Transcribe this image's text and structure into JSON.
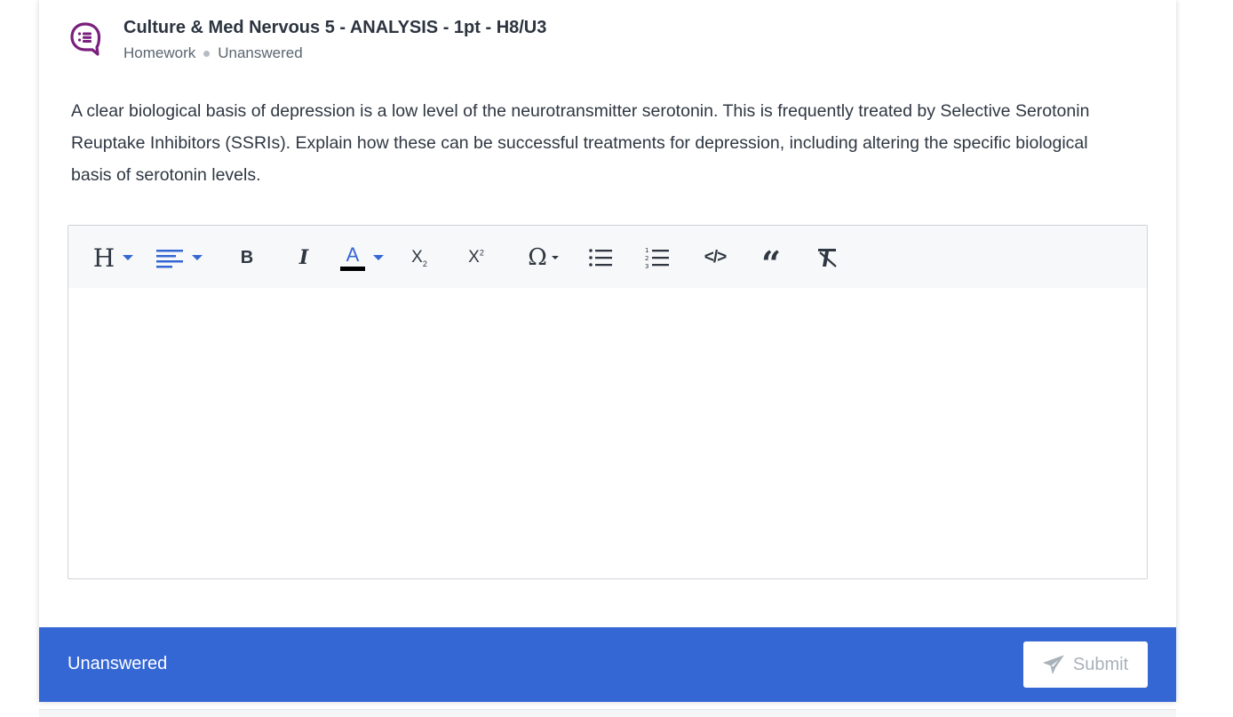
{
  "question": {
    "title": "Culture & Med Nervous 5 - ANALYSIS - 1pt - H8/U3",
    "type": "Homework",
    "status": "Unanswered",
    "icon": "question-bubble-icon",
    "prompt": "A clear biological basis of depression is a low level of the neurotransmitter serotonin. This is frequently treated by Selective Serotonin Reuptake Inhibitors (SSRIs). Explain how these can be successful treatments for depression, including altering the specific biological basis of serotonin levels."
  },
  "toolbar": {
    "heading_label": "H",
    "bold_label": "B",
    "italic_label": "I",
    "color_label": "A",
    "subscript_label": "X",
    "subscript_small": "2",
    "superscript_label": "X",
    "superscript_small": "2",
    "special_char_label": "Ω",
    "quote_label": "❝❝",
    "code_label": "</>",
    "icons": [
      "heading-icon",
      "align-icon",
      "bold-icon",
      "italic-icon",
      "text-color-icon",
      "subscript-icon",
      "superscript-icon",
      "special-character-icon",
      "bulleted-list-icon",
      "numbered-list-icon",
      "code-icon",
      "blockquote-icon",
      "clear-format-icon"
    ]
  },
  "footer": {
    "status": "Unanswered",
    "submit_label": "Submit"
  },
  "colors": {
    "accent": "#3567d4",
    "icon_purple": "#7a1f7d",
    "toolbar_blue": "#3567d4"
  }
}
